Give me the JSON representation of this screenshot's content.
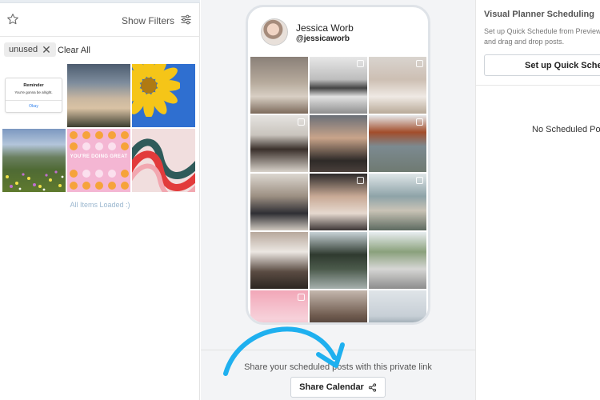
{
  "left_panel": {
    "show_filters_label": "Show Filters",
    "filter_chip_label": "unused",
    "chip_remove_glyph": "✕",
    "clear_all_label": "Clear All",
    "reminder_card": {
      "title": "Reminder",
      "body": "You're gonna be alright.",
      "action": "Okay"
    },
    "graphic_text": "YOU'RE DOING GREAT",
    "status_text": "All Items Loaded :)"
  },
  "preview": {
    "profile_name": "Jessica Worb",
    "profile_handle": "@jessicaworb",
    "share_text": "Share your scheduled posts with this private link",
    "share_button_label": "Share Calendar"
  },
  "right_panel": {
    "title": "Visual Planner Scheduling",
    "description": "Set up Quick Schedule from Preview feed, and drag and drop posts.",
    "quick_schedule_button_label": "Set up Quick Schedule",
    "empty_state": "No Scheduled Posts"
  },
  "colors": {
    "accent_arrow": "#1fb0ef",
    "panel_border": "#e3e3e3",
    "muted_text": "#9bb7cf"
  },
  "icons": [
    "star-icon",
    "filters-icon",
    "close-icon",
    "share-icon",
    "curved-arrow-icon"
  ]
}
